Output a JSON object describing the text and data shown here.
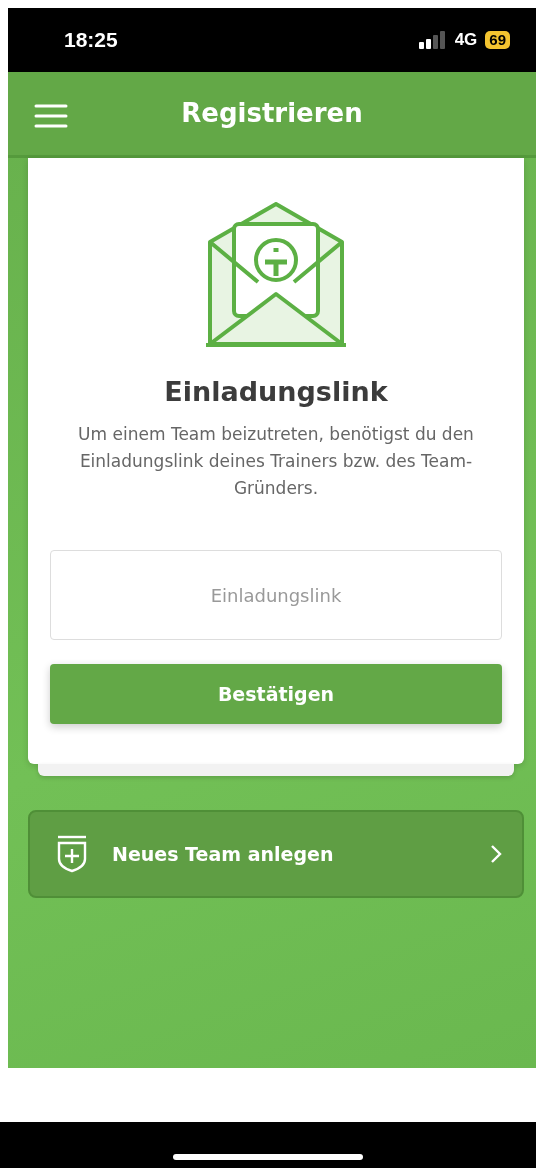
{
  "status_bar": {
    "time": "18:25",
    "network": "4G",
    "battery": "69"
  },
  "header": {
    "title": "Registrieren"
  },
  "card": {
    "heading": "Einladungslink",
    "description": "Um einem Team beizutreten, benötigst du den Einladungslink deines Trainers bzw. des Team-Gründers.",
    "input": {
      "placeholder": "Einladungslink"
    },
    "button": "Bestätigen"
  },
  "new_team": {
    "label": "Neues Team anlegen"
  }
}
